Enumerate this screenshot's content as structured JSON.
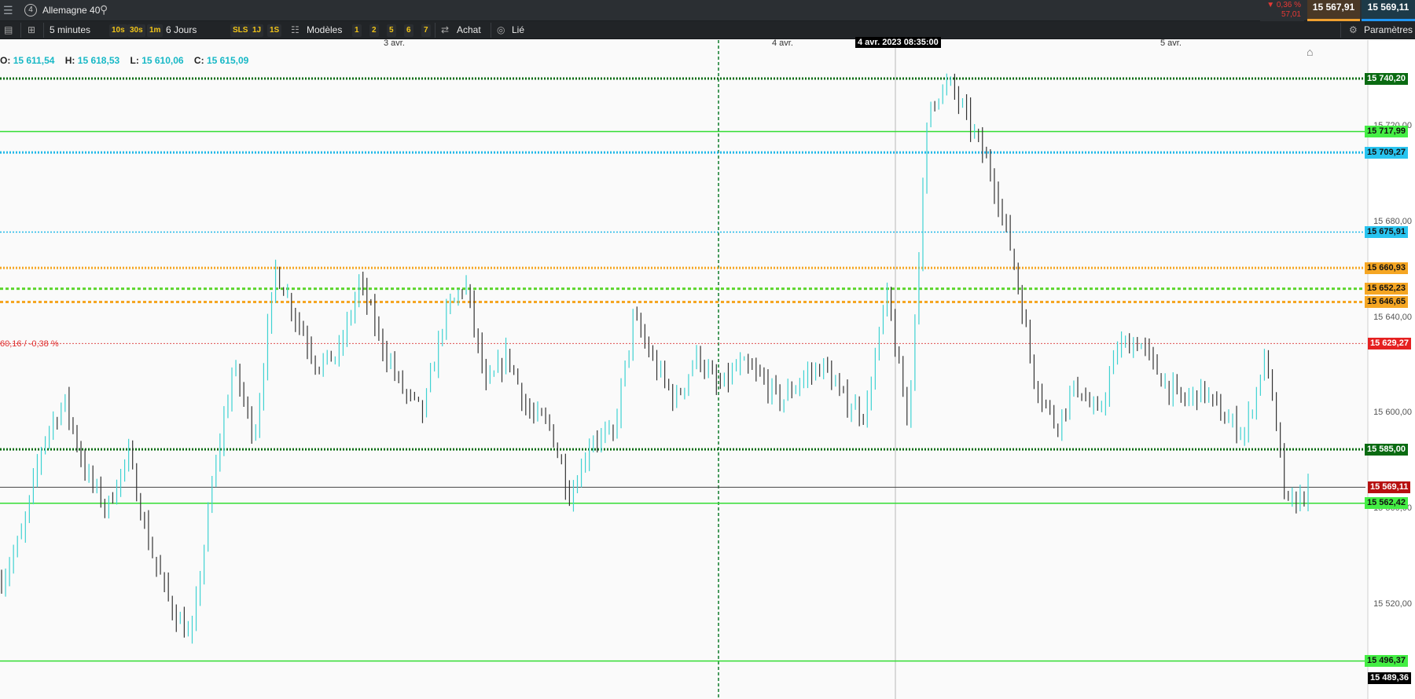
{
  "instrument": {
    "name": "Allemagne 40",
    "index_badge": "4"
  },
  "quote": {
    "change_pct": "▼ 0,36 %",
    "change_abs": "57,01",
    "bid": "15 567,91",
    "ask": "15 569,11"
  },
  "toolbar": {
    "interval_label": "5 minutes",
    "intervals": [
      "10s",
      "30s",
      "1m"
    ],
    "period_label": "6 Jours",
    "quick": [
      "SLS",
      "1J",
      "1S"
    ],
    "models_label": "Modèles",
    "numbers": [
      "1",
      "2",
      "5",
      "6",
      "7"
    ],
    "buy_label": "Achat",
    "linked_label": "Lié",
    "settings_label": "Paramètres"
  },
  "ohlc": {
    "o_label": "O:",
    "o": "15 611,54",
    "h_label": "H:",
    "h": "15 618,53",
    "l_label": "L:",
    "l": "15 610,06",
    "c_label": "C:",
    "c": "15 615,09"
  },
  "dates": {
    "d1": "3 avr.",
    "d2": "4 avr.",
    "d3": "5 avr.",
    "crosshair": "4 avr. 2023 08:35:00"
  },
  "diff_label": "60,16 / -0,38 %",
  "colors": {
    "candle_up": "#3fd2d2",
    "candle_down": "#333333",
    "green": "#22cc22",
    "dark_green": "#1a7a1a",
    "cyan": "#1ec0e6",
    "orange": "#f5a623",
    "red": "#e02020"
  },
  "chart_data": {
    "type": "candlestick",
    "ylim": [
      15480,
      15755
    ],
    "x_dates": [
      "3 avr.",
      "4 avr.",
      "5 avr."
    ],
    "y_ticks": [
      "15 720,00",
      "15 680,00",
      "15 640,00",
      "15 600,00",
      "15 560,00",
      "15 520,00"
    ],
    "y_tick_values": [
      15720,
      15680,
      15640,
      15600,
      15560,
      15520
    ],
    "levels": [
      {
        "value": 15740.2,
        "label": "15 740,20",
        "style": "dotted-dark-green"
      },
      {
        "value": 15717.99,
        "label": "15 717,99",
        "style": "solid-green"
      },
      {
        "value": 15709.27,
        "label": "15 709,27",
        "style": "dotted-cyan-thick"
      },
      {
        "value": 15675.91,
        "label": "15 675,91",
        "style": "dotted-cyan"
      },
      {
        "value": 15660.93,
        "label": "15 660,93",
        "style": "dotted-orange"
      },
      {
        "value": 15652.23,
        "label": "15 652,23",
        "style": "dashed-green-orange"
      },
      {
        "value": 15646.65,
        "label": "15 646,65",
        "style": "dashed-orange"
      },
      {
        "value": 15629.27,
        "label": "15 629,27",
        "style": "dotted-red"
      },
      {
        "value": 15585.0,
        "label": "15 585,00",
        "style": "dotted-dark-green"
      },
      {
        "value": 15569.11,
        "label": "15 569,11",
        "style": "solid-grey-current"
      },
      {
        "value": 15562.42,
        "label": "15 562,42",
        "style": "solid-green"
      },
      {
        "value": 15496.37,
        "label": "15 496,37",
        "style": "solid-green"
      },
      {
        "value": 15489.36,
        "label": "15 489,36",
        "style": "plain-black"
      }
    ],
    "price_path": [
      15530,
      15550,
      15590,
      15605,
      15575,
      15560,
      15583,
      15545,
      15520,
      15505,
      15570,
      15620,
      15590,
      15660,
      15640,
      15620,
      15625,
      15655,
      15630,
      15610,
      15600,
      15640,
      15655,
      15610,
      15625,
      15600,
      15595,
      15565,
      15590,
      15590,
      15640,
      15620,
      15605,
      15625,
      15610,
      15620,
      15615,
      15605,
      15615,
      15620,
      15605,
      15600,
      15650,
      15595,
      15730,
      15738,
      15720,
      15700,
      15665,
      15615,
      15595,
      15612,
      15598,
      15628,
      15630,
      15615,
      15605,
      15610,
      15598,
      15592,
      15625,
      15560,
      15568
    ]
  }
}
